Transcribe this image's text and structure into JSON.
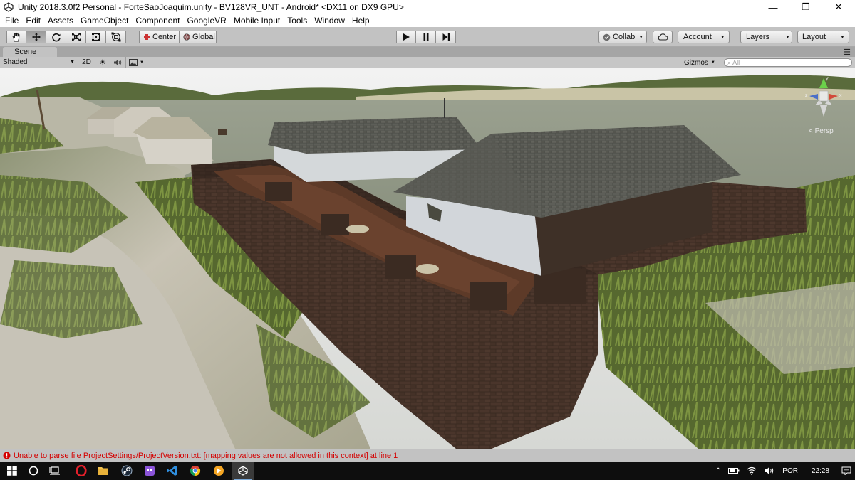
{
  "window": {
    "title": "Unity 2018.3.0f2 Personal - ForteSaoJoaquim.unity - BV128VR_UNT - Android* <DX11 on DX9 GPU>",
    "minimize_glyph": "—",
    "maximize_glyph": "❐",
    "close_glyph": "✕"
  },
  "menu": [
    "File",
    "Edit",
    "Assets",
    "GameObject",
    "Component",
    "GoogleVR",
    "Mobile Input",
    "Tools",
    "Window",
    "Help"
  ],
  "toolbar": {
    "tools": [
      "hand-icon",
      "move-icon",
      "rotate-icon",
      "scale-icon",
      "rect-icon",
      "transform-icon"
    ],
    "active_tool": 1,
    "pivot_label": "Center",
    "space_label": "Global",
    "collab_label": "Collab",
    "account_label": "Account",
    "layers_label": "Layers",
    "layout_label": "Layout"
  },
  "scene_tab": {
    "label": "Scene",
    "draw_mode": "Shaded",
    "mode_2d": "2D",
    "gizmos_label": "Gizmos",
    "search_placeholder": "All",
    "projection": "Persp"
  },
  "status": {
    "message": "Unable to parse file ProjectSettings/ProjectVersion.txt: [mapping values are not allowed in this context] at line 1",
    "color": "#d40000"
  },
  "taskbar": {
    "language": "POR",
    "time": "22:28"
  },
  "colors": {
    "accent": "#7aa8d8",
    "toolbar": "#c2c2c2",
    "taskbar": "#0e0e0e"
  }
}
